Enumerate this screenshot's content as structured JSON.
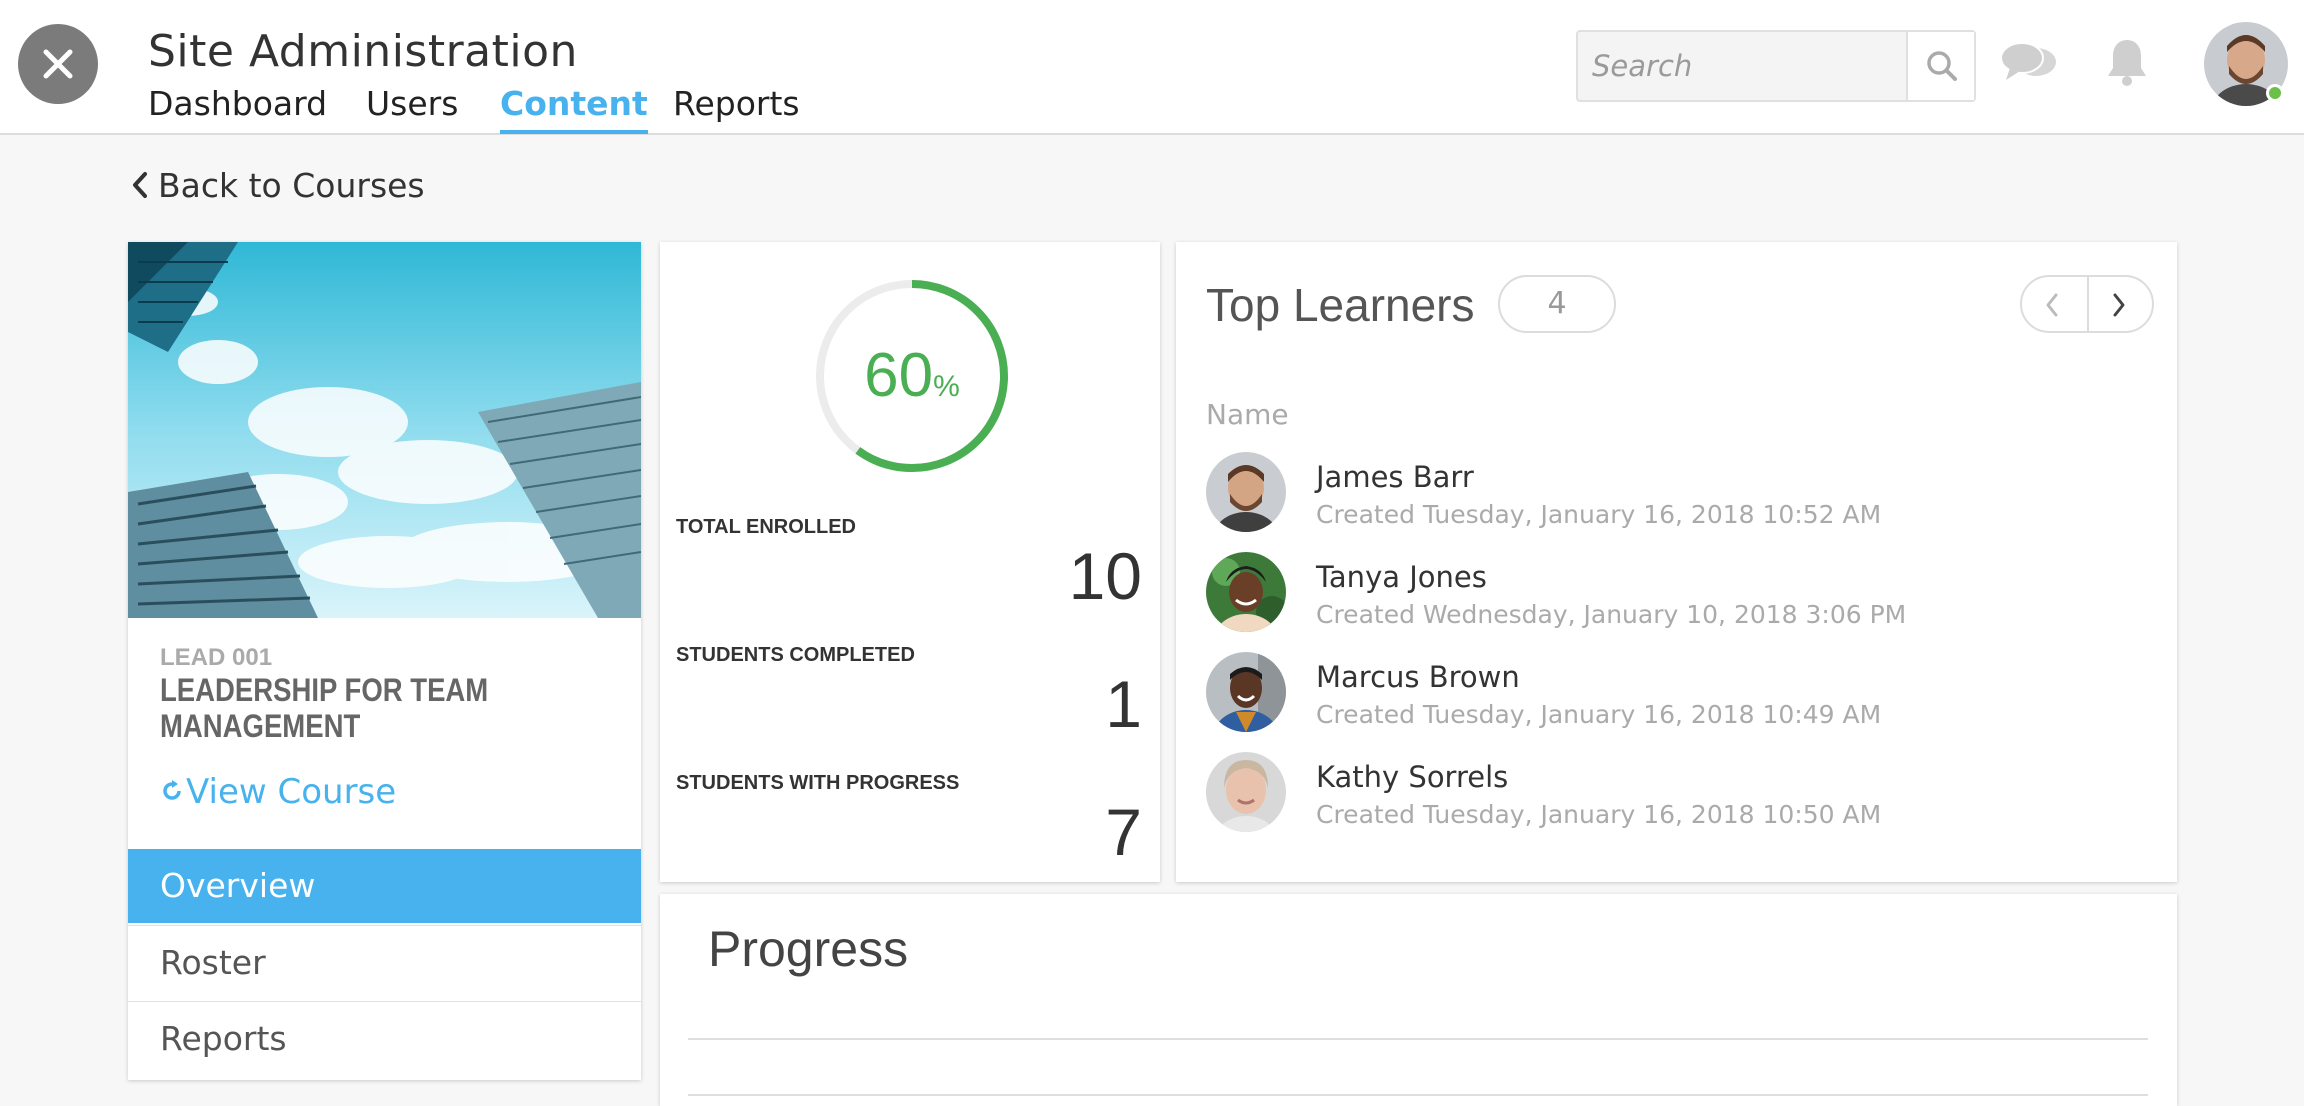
{
  "header": {
    "title": "Site Administration",
    "tabs": [
      {
        "label": "Dashboard",
        "active": false
      },
      {
        "label": "Users",
        "active": false
      },
      {
        "label": "Content",
        "active": true
      },
      {
        "label": "Reports",
        "active": false
      }
    ],
    "search": {
      "placeholder": "Search",
      "value": ""
    },
    "icons": [
      "close-icon",
      "search-icon",
      "chat-icon",
      "bell-icon"
    ],
    "user_status": "online"
  },
  "back_link": {
    "label": "Back to Courses"
  },
  "course": {
    "code": "LEAD 001",
    "name": "LEADERSHIP FOR TEAM MANAGEMENT",
    "view_label": "View Course"
  },
  "side_menu": {
    "items": [
      {
        "label": "Overview",
        "active": true
      },
      {
        "label": "Roster",
        "active": false
      },
      {
        "label": "Reports",
        "active": false
      }
    ]
  },
  "stats": {
    "completion_percent": 60,
    "percent_number": "60",
    "percent_sign": "%",
    "total_enrolled_label": "TOTAL ENROLLED",
    "total_enrolled": "10",
    "completed_label": "STUDENTS COMPLETED",
    "completed": "1",
    "progress_label": "STUDENTS WITH PROGRESS",
    "with_progress": "7"
  },
  "top_learners": {
    "title": "Top Learners",
    "count": "4",
    "column_header": "Name",
    "learners": [
      {
        "name": "James Barr",
        "created": "Created Tuesday, January 16, 2018 10:52 AM"
      },
      {
        "name": "Tanya Jones",
        "created": "Created Wednesday, January 10, 2018 3:06 PM"
      },
      {
        "name": "Marcus Brown",
        "created": "Created Tuesday, January 16, 2018 10:49 AM"
      },
      {
        "name": "Kathy Sorrels",
        "created": "Created Tuesday, January 16, 2018 10:50 AM"
      }
    ]
  },
  "progress": {
    "title": "Progress"
  },
  "colors": {
    "accent": "#47b2ee",
    "success": "#4aae52",
    "online": "#6cc04a"
  }
}
